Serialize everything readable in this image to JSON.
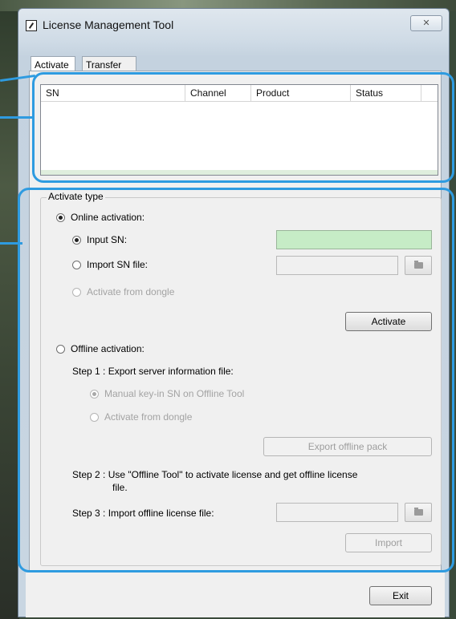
{
  "window": {
    "title": "License Management Tool",
    "close_glyph": "✕"
  },
  "tabs": [
    {
      "label": "Activate",
      "active": true
    },
    {
      "label": "Transfer",
      "active": false
    }
  ],
  "table": {
    "columns": [
      "SN",
      "Channel",
      "Product",
      "Status"
    ],
    "rows": []
  },
  "activate_type": {
    "legend": "Activate type",
    "online": {
      "label": "Online activation:",
      "checked": true,
      "input_sn": {
        "label": "Input SN:",
        "checked": true,
        "value": ""
      },
      "import_sn_file": {
        "label": "Import SN file:",
        "checked": false,
        "value": ""
      },
      "from_dongle": {
        "label": "Activate from dongle",
        "disabled": true
      },
      "activate_button": "Activate"
    },
    "offline": {
      "label": "Offline activation:",
      "checked": false,
      "step1": "Step 1 : Export server information file:",
      "manual_key_in": "Manual key-in SN on Offline Tool",
      "from_dongle": "Activate from dongle",
      "export_button": "Export offline pack",
      "step2_line1": "Step 2 : Use \"Offline Tool\" to activate license and get offline license",
      "step2_line2": "file.",
      "step3": "Step 3 : Import offline license file:",
      "import_button": "Import"
    }
  },
  "exit_button": "Exit",
  "colors": {
    "annotation": "#2e9be0",
    "sn_input_bg": "#c6ecc6"
  }
}
